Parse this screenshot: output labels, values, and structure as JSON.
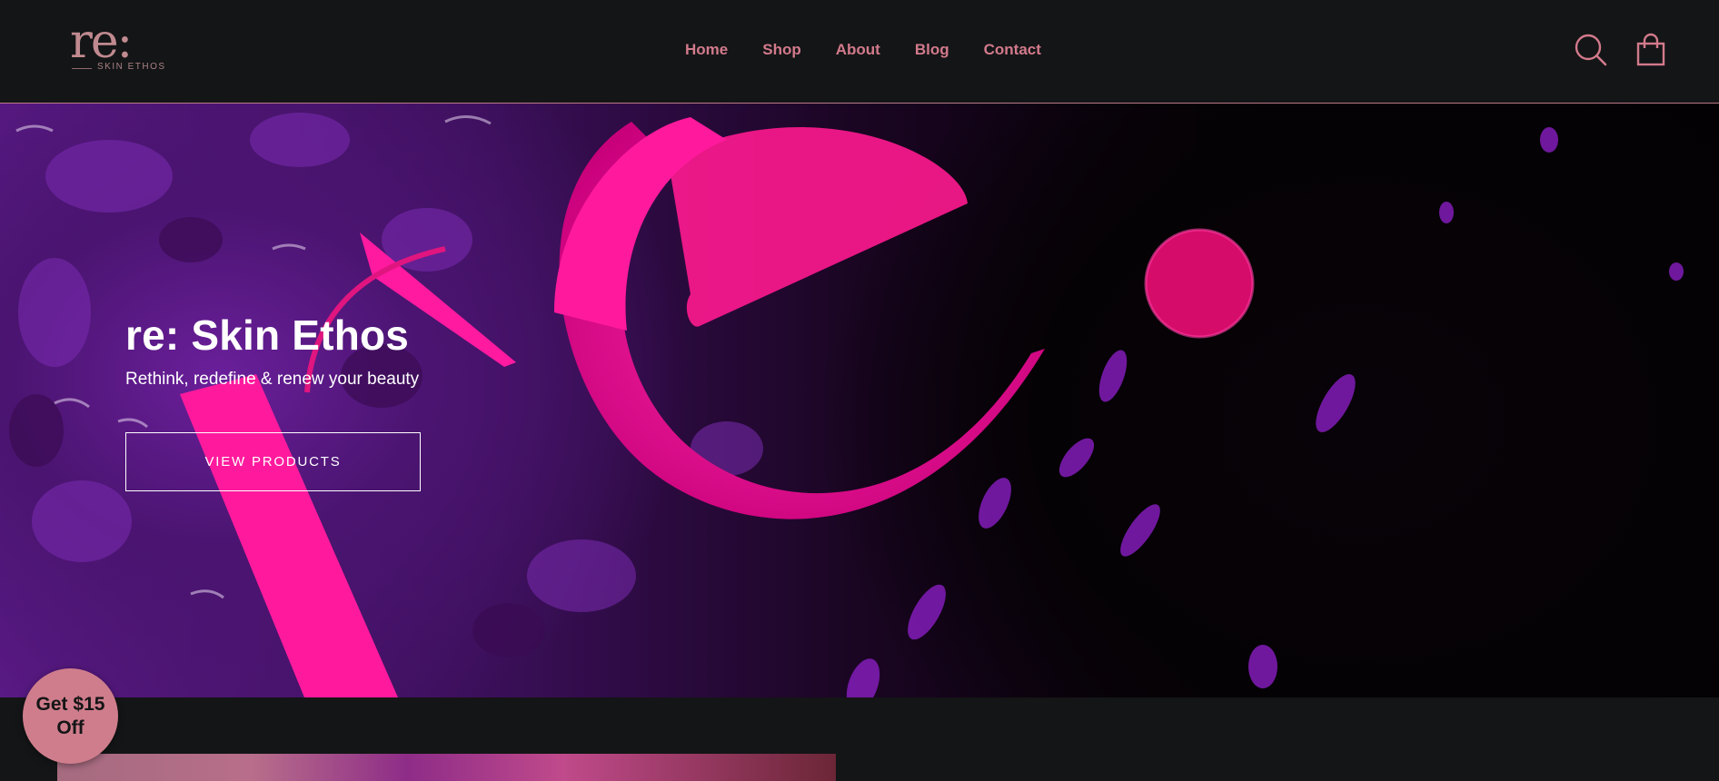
{
  "brand": {
    "logo_mark": "re:",
    "logo_subtitle": "SKIN ETHOS"
  },
  "nav": {
    "items": [
      {
        "label": "Home"
      },
      {
        "label": "Shop"
      },
      {
        "label": "About"
      },
      {
        "label": "Blog"
      },
      {
        "label": "Contact"
      }
    ]
  },
  "header_icons": {
    "search": "search-icon",
    "cart": "shopping-bag-icon"
  },
  "hero": {
    "title": "re: Skin Ethos",
    "subtitle": "Rethink, redefine & renew your beauty",
    "button_label": "VIEW PRODUCTS"
  },
  "discount_badge": {
    "label": "Get $15 Off"
  },
  "colors": {
    "header_bg": "#141516",
    "nav_accent": "#d27a8c",
    "logo": "#c08a90",
    "hero_pink": "#ff1a9d",
    "hero_purple": "#5a1a86",
    "badge_bg": "#cf7d8c"
  }
}
